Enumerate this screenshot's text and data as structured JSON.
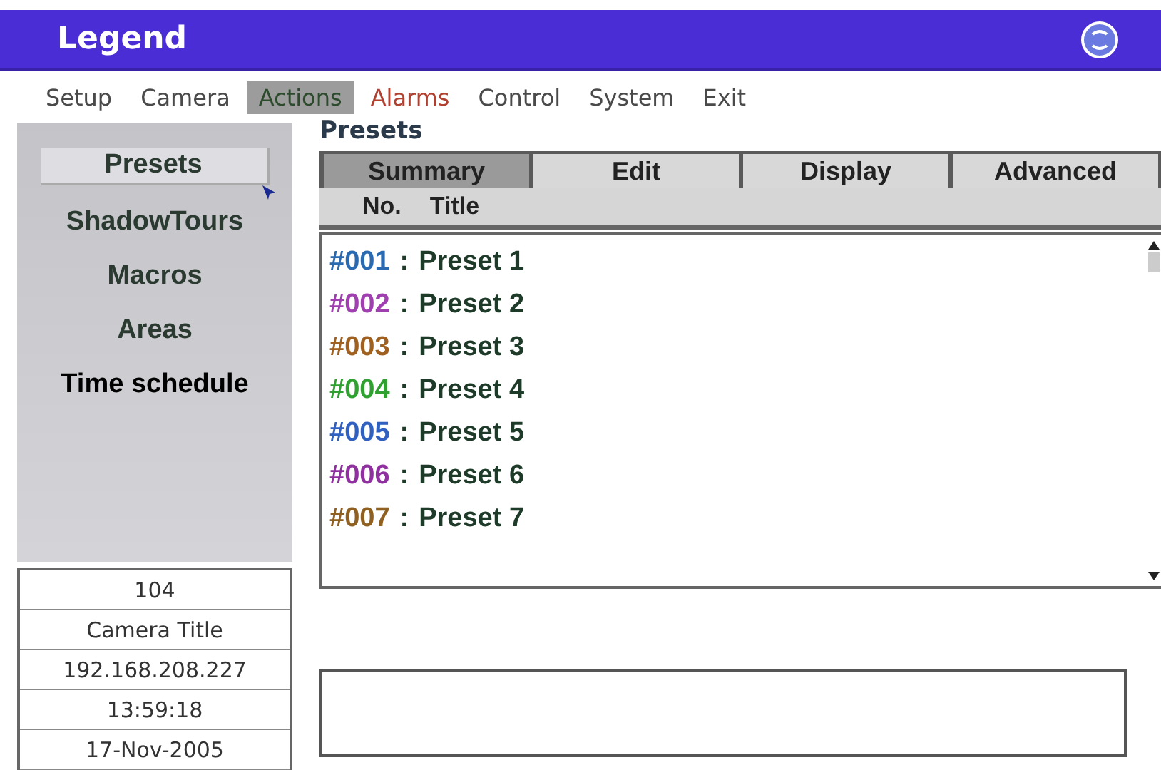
{
  "window": {
    "title": "Legend"
  },
  "menu": [
    {
      "label": "Setup",
      "selected": false,
      "kind": "normal"
    },
    {
      "label": "Camera",
      "selected": false,
      "kind": "normal"
    },
    {
      "label": "Actions",
      "selected": true,
      "kind": "normal"
    },
    {
      "label": "Alarms",
      "selected": false,
      "kind": "alert"
    },
    {
      "label": "Control",
      "selected": false,
      "kind": "normal"
    },
    {
      "label": "System",
      "selected": false,
      "kind": "normal"
    },
    {
      "label": "Exit",
      "selected": false,
      "kind": "normal"
    }
  ],
  "sidebar": {
    "items": [
      {
        "label": "Presets",
        "selected": true,
        "color": "#2a3a30"
      },
      {
        "label": "ShadowTours",
        "selected": false,
        "color": "#2a3a30"
      },
      {
        "label": "Macros",
        "selected": false,
        "color": "#2a3a30"
      },
      {
        "label": "Areas",
        "selected": false,
        "color": "#2a3a30"
      },
      {
        "label": "Time schedule",
        "selected": false,
        "color": "#000000"
      }
    ]
  },
  "info": [
    "104",
    "Camera Title",
    "192.168.208.227",
    "13:59:18",
    "17-Nov-2005"
  ],
  "panel": {
    "title": "Presets",
    "tabs": [
      {
        "label": "Summary",
        "selected": true
      },
      {
        "label": "Edit",
        "selected": false
      },
      {
        "label": "Display",
        "selected": false
      },
      {
        "label": "Advanced",
        "selected": false
      }
    ],
    "columns": [
      "No.",
      "Title"
    ],
    "rows": [
      {
        "number": "#001",
        "separator": ":",
        "title": "Preset 1",
        "color": "#2a6ab0"
      },
      {
        "number": "#002",
        "separator": ":",
        "title": "Preset 2",
        "color": "#a040b0"
      },
      {
        "number": "#003",
        "separator": ":",
        "title": "Preset 3",
        "color": "#a06020"
      },
      {
        "number": "#004",
        "separator": ":",
        "title": "Preset 4",
        "color": "#30a030"
      },
      {
        "number": "#005",
        "separator": ":",
        "title": "Preset 5",
        "color": "#3060c0"
      },
      {
        "number": "#006",
        "separator": ":",
        "title": "Preset 6",
        "color": "#9030a0"
      },
      {
        "number": "#007",
        "separator": ":",
        "title": "Preset 7",
        "color": "#906020"
      }
    ]
  }
}
